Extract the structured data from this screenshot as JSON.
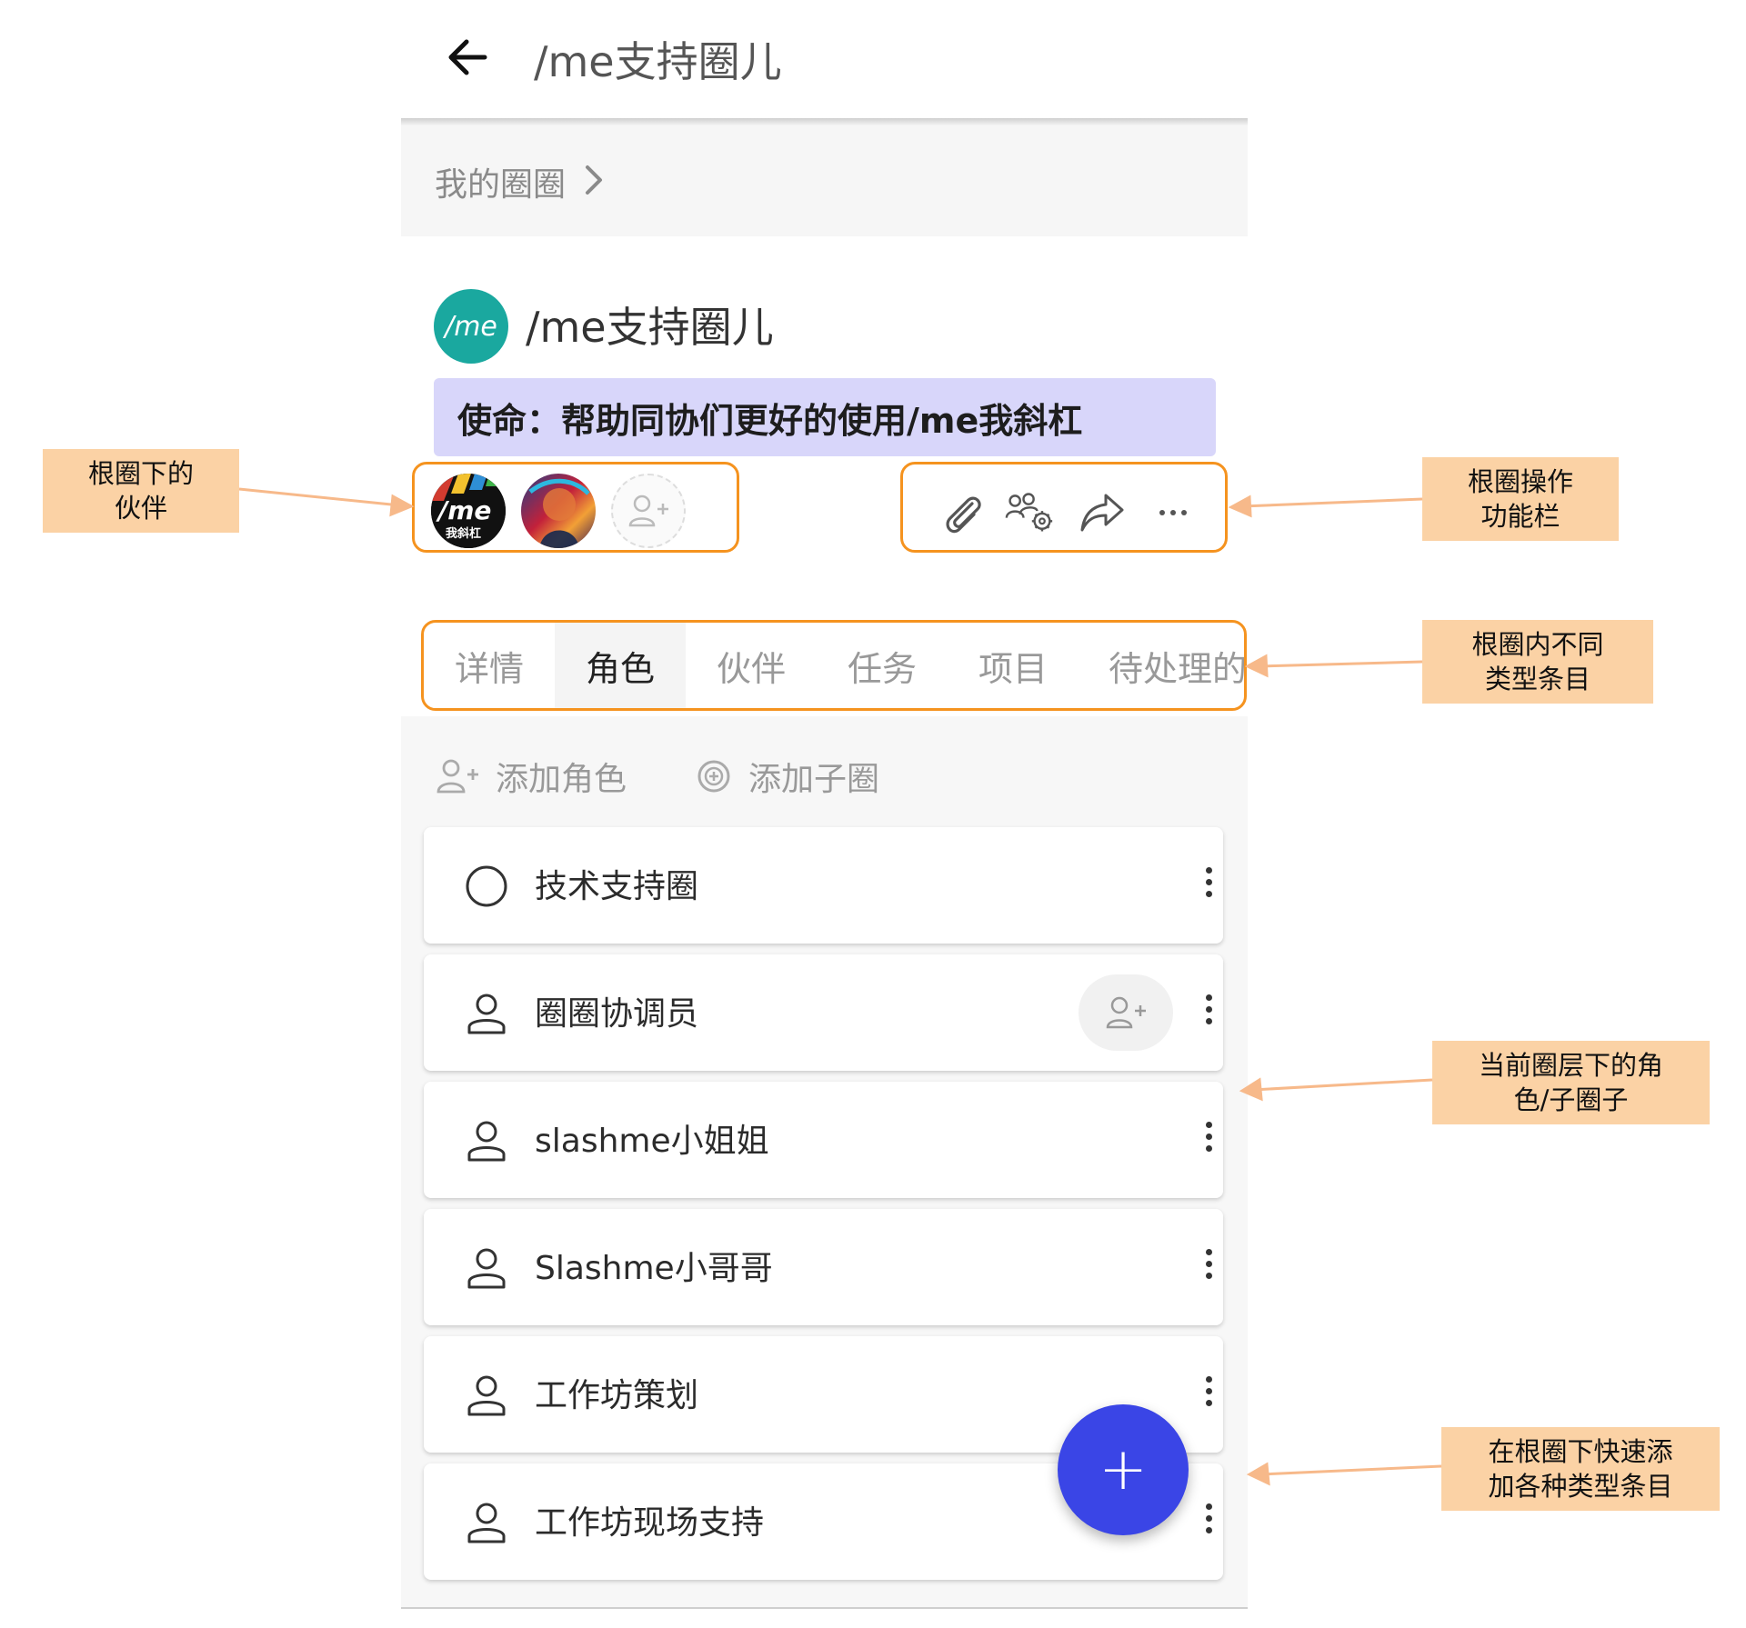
{
  "topbar": {
    "title": "/me支持圈儿"
  },
  "breadcrumb": {
    "label": "我的圈圈"
  },
  "circle": {
    "avatar_text": "/me",
    "name": "/me支持圈儿",
    "mission": "使命：帮助同协们更好的使用/me我斜杠"
  },
  "partners": {
    "first_avatar_text": "/me",
    "first_avatar_subtext": "我斜杠"
  },
  "actions": [
    "paperclip-icon",
    "group-settings-icon",
    "share-icon",
    "more-icon"
  ],
  "tabs": [
    {
      "label": "详情",
      "active": false
    },
    {
      "label": "角色",
      "active": true
    },
    {
      "label": "伙伴",
      "active": false
    },
    {
      "label": "任务",
      "active": false
    },
    {
      "label": "项目",
      "active": false
    },
    {
      "label": "待处理的",
      "active": false
    }
  ],
  "toolbar": {
    "add_role": "添加角色",
    "add_subcircle": "添加子圈"
  },
  "items": [
    {
      "label": "技术支持圈",
      "icon": "circle-icon"
    },
    {
      "label": "圈圈协调员",
      "icon": "person-icon"
    },
    {
      "label": "slashme小姐姐",
      "icon": "person-icon"
    },
    {
      "label": "Slashme小哥哥",
      "icon": "person-icon"
    },
    {
      "label": "工作坊策划",
      "icon": "person-icon"
    },
    {
      "label": "工作坊现场支持",
      "icon": "person-icon"
    }
  ],
  "fab": {
    "label": "+"
  },
  "annotations": {
    "partners": [
      "根圈下的",
      "伙伴"
    ],
    "actions": [
      "根圈操作",
      "功能栏"
    ],
    "tabs": [
      "根圈内不同",
      "类型条目"
    ],
    "items": [
      "当前圈层下的角",
      "色/子圈子"
    ],
    "fab": [
      "在根圈下快速添",
      "加各种类型条目"
    ]
  },
  "colors": {
    "accent": "#3a45e6",
    "annotation_border": "#f5931f",
    "annotation_fill": "#fbd2a5",
    "mission_bg": "#d8d6fa",
    "circle_avatar": "#1aa89f"
  }
}
